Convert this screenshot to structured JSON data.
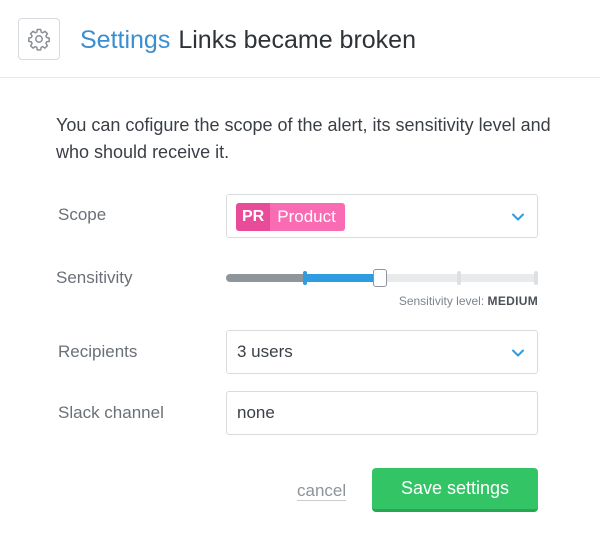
{
  "header": {
    "breadcrumb_settings": "Settings",
    "alert_name": "Links became broken",
    "icon": "gear-icon"
  },
  "intro": "You can cofigure the scope of the alert, its sensitivity level and who should receive it.",
  "form": {
    "scope": {
      "label": "Scope",
      "tag_abbr": "PR",
      "tag_name": "Product",
      "tag_color": "#f96cb4",
      "tag_abbr_color": "#e84b97"
    },
    "sensitivity": {
      "label": "Sensitivity",
      "caption": "Sensitivity level:",
      "level": "MEDIUM",
      "value_fraction": 0.5,
      "steps": 5,
      "fill_color": "#2f9be0"
    },
    "recipients": {
      "label": "Recipients",
      "value": "3 users"
    },
    "slack": {
      "label": "Slack channel",
      "value": "none"
    }
  },
  "actions": {
    "cancel_label": "cancel",
    "save_label": "Save settings",
    "save_color": "#33c466"
  },
  "colors": {
    "accent": "#3a8fd0",
    "chevron": "#2f9be0"
  }
}
